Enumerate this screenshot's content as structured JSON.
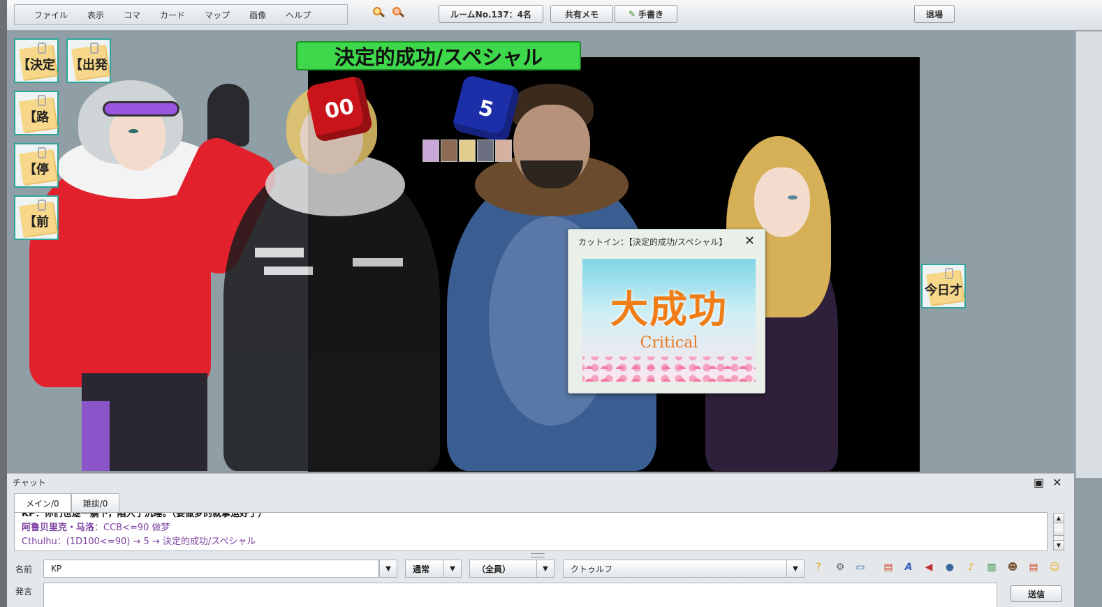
{
  "menu": [
    "ファイル",
    "表示",
    "コマ",
    "カード",
    "マップ",
    "画像",
    "ヘルプ"
  ],
  "toolbar": {
    "room": "ルームNo.137：4名",
    "shared_memo": "共有メモ",
    "handwriting": "手書き",
    "exit": "退場"
  },
  "cards": [
    "【決定",
    "【出発",
    "【路",
    "【停",
    "【前",
    "今日才"
  ],
  "cutin_banner": "決定的成功/スペシャル",
  "dice": [
    {
      "label": "00",
      "color": "#c8141a"
    },
    {
      "label": "5",
      "color": "#1c2fa8"
    }
  ],
  "cutin_window": {
    "title": "カットイン：【決定的成功/スペシャル】",
    "image_main": "大成功",
    "image_sub": "Critical"
  },
  "chat": {
    "title": "チャット",
    "tabs": [
      "メイン/0",
      "雑談/0"
    ],
    "log": [
      "KP：你们也逐一躺下，陷入了沉睡。（要做梦的就掌运好了）",
      {
        "name": "阿鲁贝里克・马洛",
        "text": "：CCB<=90 做梦"
      },
      "Cthulhu：(1D100<=90) → 5 → 決定的成功/スペシャル"
    ],
    "name_label": "名前",
    "name_value": "KP",
    "mode": "通常",
    "target": "（全員）",
    "system": "クトゥルフ",
    "speech_label": "発言",
    "send": "送信"
  },
  "colors": {
    "banner": "#3ed94a",
    "log_purple": "#7b3fa0",
    "card_border": "#2fa59a"
  }
}
